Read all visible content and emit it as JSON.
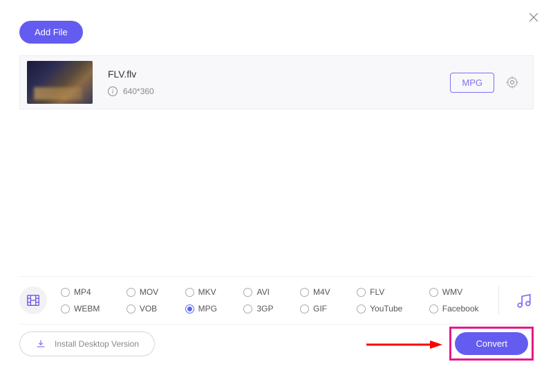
{
  "header": {
    "add_file_label": "Add File"
  },
  "file": {
    "name": "FLV.flv",
    "resolution": "640*360",
    "target_format": "MPG"
  },
  "formats": [
    {
      "label": "MP4",
      "selected": false
    },
    {
      "label": "MOV",
      "selected": false
    },
    {
      "label": "MKV",
      "selected": false
    },
    {
      "label": "AVI",
      "selected": false
    },
    {
      "label": "M4V",
      "selected": false
    },
    {
      "label": "FLV",
      "selected": false
    },
    {
      "label": "WMV",
      "selected": false
    },
    {
      "label": "WEBM",
      "selected": false
    },
    {
      "label": "VOB",
      "selected": false
    },
    {
      "label": "MPG",
      "selected": true
    },
    {
      "label": "3GP",
      "selected": false
    },
    {
      "label": "GIF",
      "selected": false
    },
    {
      "label": "YouTube",
      "selected": false
    },
    {
      "label": "Facebook",
      "selected": false
    }
  ],
  "footer": {
    "install_label": "Install Desktop Version",
    "convert_label": "Convert"
  }
}
